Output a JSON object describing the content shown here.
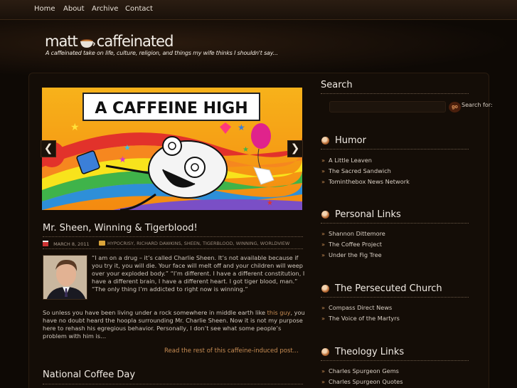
{
  "nav": {
    "items": [
      "Home",
      "About",
      "Archive",
      "Contact"
    ]
  },
  "header": {
    "logo_left": "matt",
    "logo_right": "caffeinated",
    "tagline": "A caffeinated take on life, culture, religion, and things my wife thinks I shouldn't say..."
  },
  "slider": {
    "banner_text": "A CAFFEINE HIGH",
    "prev": "❮",
    "next": "❯"
  },
  "post": {
    "title": "Mr. Sheen, Winning & Tigerblood!",
    "date": "MARCH 8, 2011",
    "tags": [
      "HYPOCRISY",
      "RICHARD DAWKINS",
      "SHEEN",
      "TIGERBLOOD",
      "WINNING",
      "WORLDVIEW"
    ],
    "excerpt_1": "“I am on a drug – it’s called Charlie Sheen. It’s not available because if you try it, you will die. Your face will melt off and your children will weep over your exploded body.” “I’m different. I have a different constitution, I have a different brain, I have a different heart. I got tiger blood, man.” “The only thing I’m addicted to right now is winning.”",
    "excerpt_2_pre": "So unless you have been living under a rock somewhere in middle earth like ",
    "excerpt_2_link": "this guy",
    "excerpt_2_post": ", you have no doubt heard the hoopla surrounding Mr. Charlie Sheen. Now it is not my purpose here to rehash his egregious behavior. Personally, I don’t see what some people’s problem with him is…",
    "read_more": "Read the rest of this caffeine-induced post..."
  },
  "post2": {
    "title": "National Coffee Day"
  },
  "sidebar": {
    "search": {
      "title": "Search",
      "button": "go",
      "label": "Search for:",
      "value": ""
    },
    "humor": {
      "title": "Humor",
      "links": [
        "A Little Leaven",
        "The Sacred Sandwich",
        "Tominthebox News Network"
      ]
    },
    "personal": {
      "title": "Personal Links",
      "links": [
        "Shannon Dittemore",
        "The Coffee Project",
        "Under the Fig Tree"
      ]
    },
    "persecuted": {
      "title": "The Persecuted Church",
      "links": [
        "Compass Direct News",
        "The Voice of the Martyrs"
      ]
    },
    "theology": {
      "title": "Theology Links",
      "links": [
        "Charles Spurgeon Gems",
        "Charles Spurgeon Quotes"
      ]
    }
  },
  "colors": {
    "accent": "#c88d54",
    "background": "#0e0905",
    "panel": "#140d07"
  }
}
